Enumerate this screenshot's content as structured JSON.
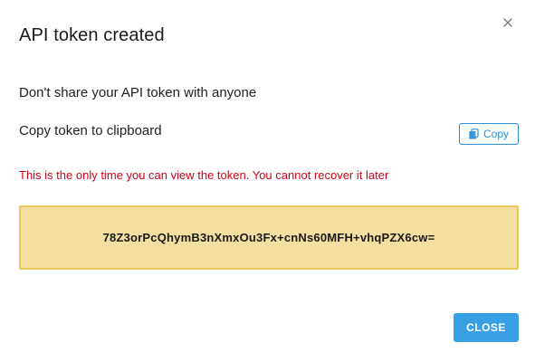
{
  "dialog": {
    "title": "API token created",
    "close_icon": "close-icon",
    "info_text": "Don't share your API token with anyone",
    "copy_label": "Copy token to clipboard",
    "copy_button_label": "Copy",
    "copy_icon": "clipboard-icon",
    "warning_text": "This is the only time you can view the token. You cannot recover it later",
    "token": "78Z3orPcQhymB3nXmxOu3Fx+cnNs60MFH+vhqPZX6cw=",
    "close_button_label": "CLOSE"
  },
  "colors": {
    "accent": "#2d8fd8",
    "primary_button": "#3aa0e6",
    "warning": "#d0021b",
    "token_bg": "#f3e0a1",
    "token_border": "#e9c65a"
  }
}
